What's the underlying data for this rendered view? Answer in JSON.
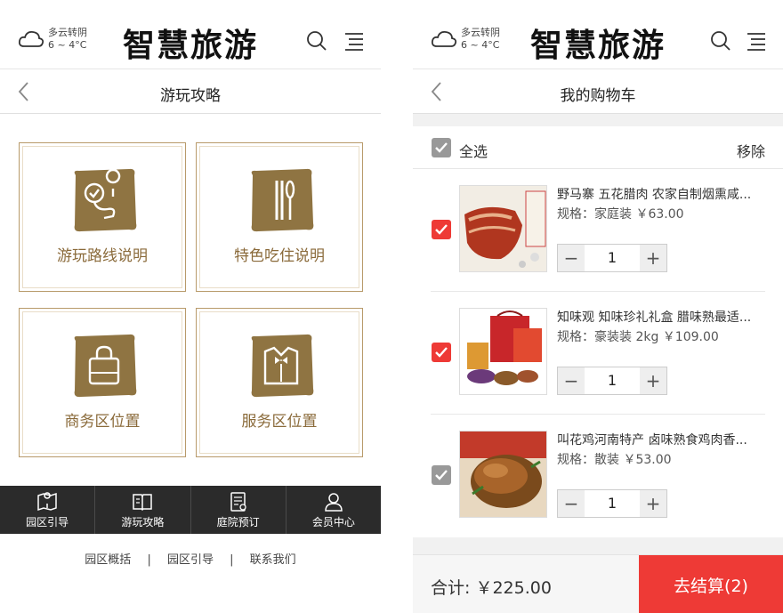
{
  "colors": {
    "accent_red": "#ee3a36",
    "gold": "#8a6a3a",
    "badge_brown": "#8f7442",
    "nav_dark": "#2b2b2b"
  },
  "header": {
    "weather_icon": "cloud-icon",
    "weather_desc": "多云转阴",
    "weather_temp": "6 ~ 4°C",
    "logo": "智慧旅游"
  },
  "left": {
    "subtitle": "游玩攻略",
    "tiles": [
      {
        "label": "游玩路线说明",
        "icon": "route-icon"
      },
      {
        "label": "特色吃住说明",
        "icon": "dining-icon"
      },
      {
        "label": "商务区位置",
        "icon": "shopping-bag-icon"
      },
      {
        "label": "服务区位置",
        "icon": "service-suit-icon"
      }
    ],
    "nav": [
      {
        "label": "园区引导",
        "icon": "map-pin-icon"
      },
      {
        "label": "游玩攻略",
        "icon": "book-icon"
      },
      {
        "label": "庭院预订",
        "icon": "booking-icon"
      },
      {
        "label": "会员中心",
        "icon": "user-icon"
      }
    ],
    "footer_links": [
      "园区概括",
      "园区引导",
      "联系我们"
    ],
    "footer_sep": "|"
  },
  "right": {
    "subtitle": "我的购物车",
    "select_all": "全选",
    "remove": "移除",
    "items": [
      {
        "name": "野马寨 五花腊肉 农家自制烟熏咸...",
        "spec": "规格：家庭装  ￥63.00",
        "qty": "1",
        "checked": true
      },
      {
        "name": "知味观 知味珍礼礼盒 腊味熟最适...",
        "spec": "规格：豪装装 2kg  ￥109.00",
        "qty": "1",
        "checked": true
      },
      {
        "name": "叫花鸡河南特产 卤味熟食鸡肉香...",
        "spec": "规格：散装  ￥53.00",
        "qty": "1",
        "checked": false
      }
    ],
    "minus": "−",
    "plus": "+",
    "total": "合计: ￥225.00",
    "checkout": "去结算(2)"
  }
}
